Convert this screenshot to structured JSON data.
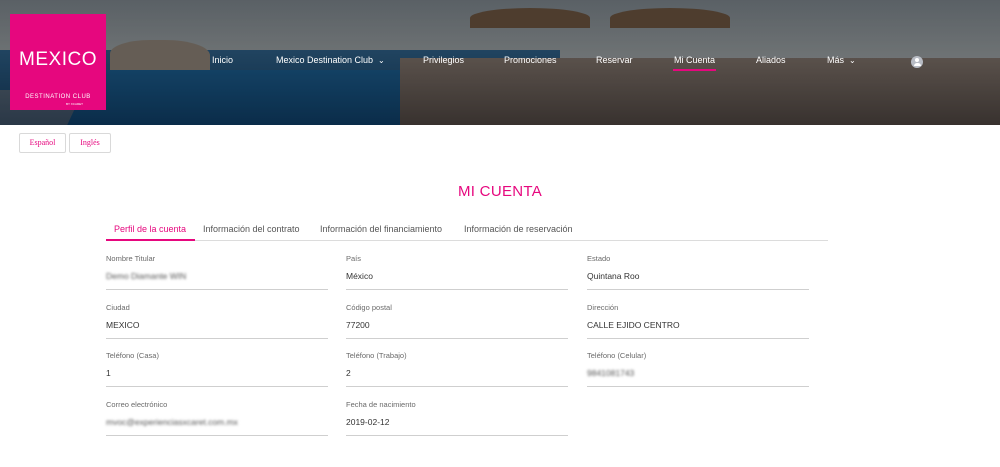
{
  "brand": {
    "logo_main": "MEXICO",
    "logo_sub": "DESTINATION CLUB",
    "logo_sub2": "BY XCARET"
  },
  "nav": [
    {
      "label": "Inicio",
      "has_dropdown": false,
      "active": false
    },
    {
      "label": "Mexico Destination Club",
      "has_dropdown": true,
      "active": false
    },
    {
      "label": "Privilegios",
      "has_dropdown": false,
      "active": false
    },
    {
      "label": "Promociones",
      "has_dropdown": false,
      "active": false
    },
    {
      "label": "Reservar",
      "has_dropdown": false,
      "active": false
    },
    {
      "label": "Mi Cuenta",
      "has_dropdown": false,
      "active": true
    },
    {
      "label": "Aliados",
      "has_dropdown": false,
      "active": false
    },
    {
      "label": "Más",
      "has_dropdown": true,
      "active": false
    }
  ],
  "user_icon": "user-avatar-icon",
  "languages": [
    "Español",
    "Inglés"
  ],
  "page_title": "MI CUENTA",
  "tabs": [
    {
      "label": "Perfil de la cuenta",
      "active": true
    },
    {
      "label": "Información del contrato",
      "active": false
    },
    {
      "label": "Información del financiamiento",
      "active": false
    },
    {
      "label": "Información de reservación",
      "active": false
    }
  ],
  "fields": [
    {
      "label": "Nombre Titular",
      "value": "Demo Diamante WIN",
      "blurred": true
    },
    {
      "label": "País",
      "value": "México",
      "blurred": false
    },
    {
      "label": "Estado",
      "value": "Quintana Roo",
      "blurred": false
    },
    {
      "label": "Ciudad",
      "value": "MEXICO",
      "blurred": false
    },
    {
      "label": "Código postal",
      "value": "77200",
      "blurred": false
    },
    {
      "label": "Dirección",
      "value": "CALLE EJIDO CENTRO",
      "blurred": false
    },
    {
      "label": "Teléfono (Casa)",
      "value": "1",
      "blurred": false
    },
    {
      "label": "Teléfono (Trabajo)",
      "value": "2",
      "blurred": false
    },
    {
      "label": "Teléfono (Celular)",
      "value": "9841081743",
      "blurred": true
    },
    {
      "label": "Correo electrónico",
      "value": "mvoc@experienciasxcaret.com.mx",
      "blurred": true
    },
    {
      "label": "Fecha de nacimiento",
      "value": "2019-02-12",
      "blurred": false
    }
  ],
  "colors": {
    "accent": "#e6077e",
    "text": "#333333",
    "label": "#6a6a6a"
  }
}
